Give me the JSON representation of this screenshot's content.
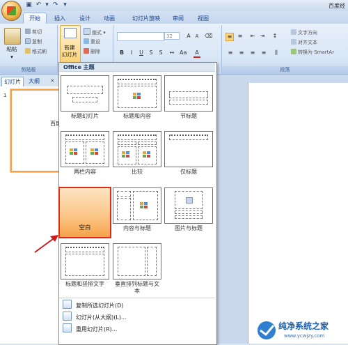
{
  "window": {
    "title": "百度经"
  },
  "ribbon_tabs": [
    "开始",
    "插入",
    "设计",
    "动画",
    "幻灯片放映",
    "审阅",
    "视图"
  ],
  "clipboard": {
    "paste": "粘贴",
    "cut": "剪切",
    "copy": "复制",
    "format_painter": "格式刷",
    "group_label": "剪贴板"
  },
  "slides_group": {
    "new_slide": "新建",
    "new_slide_2": "幻灯片",
    "layout": "版式",
    "reset": "重设",
    "delete": "删除"
  },
  "font": {
    "size": "32"
  },
  "paragraph": {
    "text_direction": "文字方向",
    "align_text": "对齐文本",
    "convert_smartart": "转换为 SmartAr",
    "group_label": "段落"
  },
  "pane_tabs": [
    "幻灯片",
    "大纲"
  ],
  "thumbnail": {
    "number": "1",
    "text": "百度"
  },
  "dropdown": {
    "header": "Office 主题",
    "layouts": [
      {
        "label": "标题幻灯片"
      },
      {
        "label": "标题和内容"
      },
      {
        "label": "节标题"
      },
      {
        "label": "两栏内容"
      },
      {
        "label": "比较"
      },
      {
        "label": "仅标题"
      },
      {
        "label": "空白"
      },
      {
        "label": "内容与标题"
      },
      {
        "label": "图片与标题"
      },
      {
        "label": "标题和竖排文字"
      },
      {
        "label": "垂直排列标题与文本"
      }
    ],
    "menu": [
      "复制所选幻灯片(D)",
      "幻灯片(从大纲)(L)...",
      "重用幻灯片(R)..."
    ]
  },
  "watermark": {
    "text": "纯净系统之家",
    "url": "www.ycwjzy.com"
  },
  "colors": {
    "selection_border": "#e02a1a",
    "selection_fill": "#fbc88a",
    "ribbon": "#d8e6f6",
    "accent": "#15428b"
  }
}
